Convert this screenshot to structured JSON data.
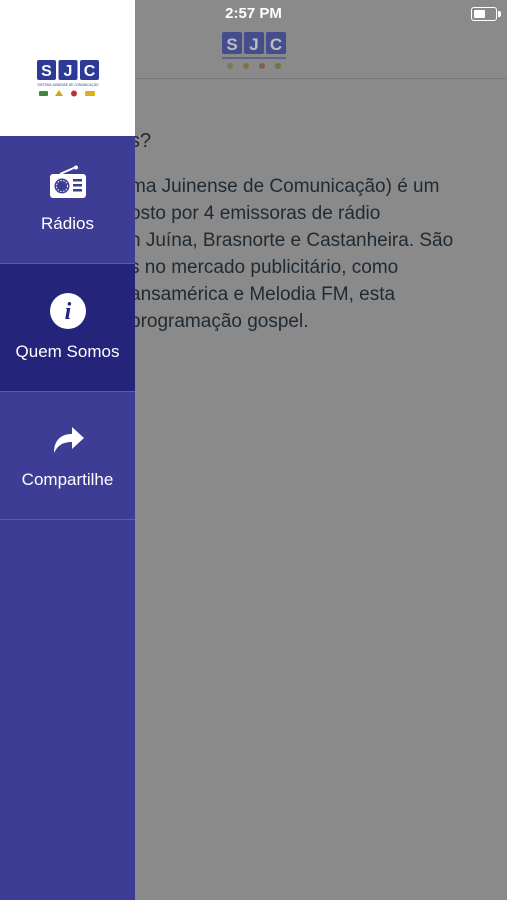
{
  "status_bar": {
    "time": "2:57 PM"
  },
  "brand": {
    "logo_letters": "SJC",
    "logo_tagline": "SISTEMA JUINENSE DE COMUNICAÇÃO",
    "primary_color": "#3d3d96",
    "active_color": "#24247a"
  },
  "content": {
    "heading": "s?",
    "lines": [
      "ma Juinense de Comunicação) é um",
      "osto por 4 emissoras de rádio",
      "n Juína, Brasnorte e Castanheira. São",
      "s no mercado publicitário, como",
      "ansamérica e Melodia FM, esta",
      "programação gospel."
    ]
  },
  "menu": {
    "items": [
      {
        "label": "Rádios",
        "icon": "radio-icon",
        "active": false
      },
      {
        "label": "Quem Somos",
        "icon": "info-icon",
        "active": true
      },
      {
        "label": "Compartilhe",
        "icon": "share-icon",
        "active": false
      }
    ]
  }
}
